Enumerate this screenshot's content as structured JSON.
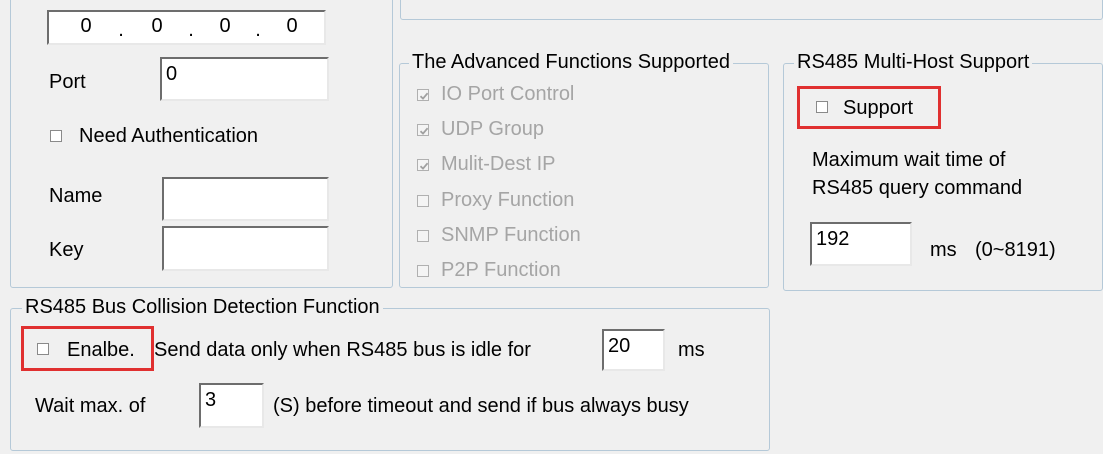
{
  "ip": {
    "octets": [
      "0",
      "0",
      "0",
      "0"
    ],
    "dot": "."
  },
  "proxy": {
    "port_label": "Port",
    "port_value": "0",
    "need_auth_label": "Need Authentication",
    "name_label": "Name",
    "name_value": "",
    "key_label": "Key",
    "key_value": ""
  },
  "advanced": {
    "title": "The Advanced Functions Supported",
    "items": [
      {
        "label": "IO Port Control",
        "checked": true
      },
      {
        "label": "UDP Group",
        "checked": true
      },
      {
        "label": "Mulit-Dest IP",
        "checked": true
      },
      {
        "label": "Proxy Function",
        "checked": false
      },
      {
        "label": "SNMP Function",
        "checked": false
      },
      {
        "label": "P2P Function",
        "checked": false
      }
    ]
  },
  "multihost": {
    "title": "RS485 Multi-Host Support",
    "support_label": "Support",
    "desc_line1": "Maximum wait time of",
    "desc_line2": "RS485  query command",
    "wait_value": "192",
    "unit": "ms",
    "range": "(0~8191)"
  },
  "collision": {
    "title": "RS485 Bus Collision Detection Function",
    "enable_label": "Enalbe.",
    "idle_text": "Send data only when RS485 bus is idle for",
    "idle_value": "20",
    "idle_unit": "ms",
    "wait_prefix": "Wait max. of",
    "wait_value": "3",
    "wait_suffix": "(S) before timeout and send if bus always busy"
  },
  "colors": {
    "highlight": "#e03030",
    "group_border": "#b5c9d8",
    "disabled_text": "#a5a5a5"
  }
}
